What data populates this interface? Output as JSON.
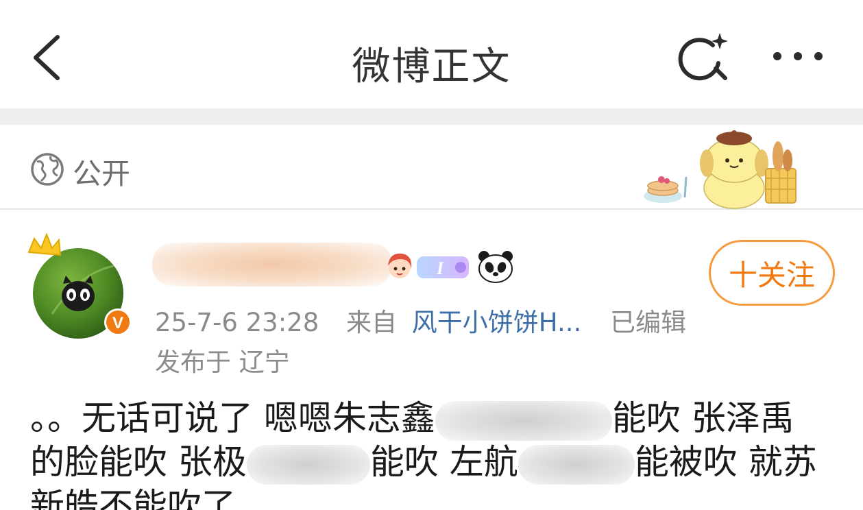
{
  "nav": {
    "title": "微博正文",
    "back_icon": "chevron-left-icon",
    "search_icon": "search-sparkle-icon",
    "more_icon": "ellipsis-icon"
  },
  "visibility": {
    "icon": "globe-icon",
    "label": "公开"
  },
  "post": {
    "author": {
      "avatar": "avatar",
      "crown_icon": "crown-icon",
      "verified_badge": "V",
      "verified_color": "#f07a10",
      "badges": [
        "girl-badge-icon",
        "letter-i-badge-icon",
        "panda-icon"
      ]
    },
    "follow_label": "十关注",
    "time": "25-7-6 23:28",
    "from_label": "来自",
    "source": "风干小饼饼H...",
    "edited": "已编辑",
    "location": "发布于 辽宁",
    "text_lines": [
      [
        "。。无话可说了 嗯嗯朱志鑫",
        "能吹 张泽禹"
      ],
      [
        "的脸能吹 张极",
        "能吹 左航",
        "能被吹 就苏"
      ],
      [
        "新皓不能吹了"
      ]
    ]
  },
  "colors": {
    "accent": "#f07a10",
    "link": "#3e6fa8",
    "muted": "#8b8b8b"
  }
}
